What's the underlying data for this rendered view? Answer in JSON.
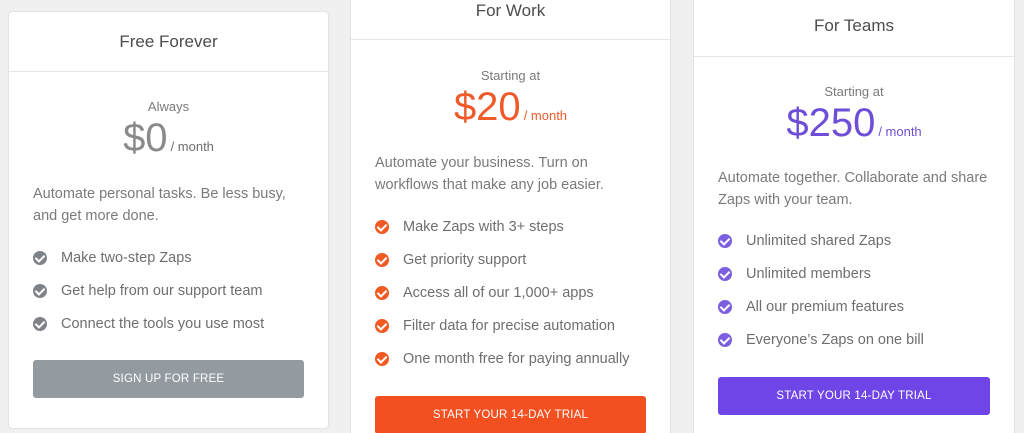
{
  "plans": {
    "free": {
      "title": "Free Forever",
      "lead": "Always",
      "price": "$0",
      "unit": "/ month",
      "description": "Automate personal tasks. Be less busy, and get more done.",
      "features": [
        "Make two-step Zaps",
        "Get help from our support team",
        "Connect the tools you use most"
      ],
      "cta": "SIGN UP FOR FREE",
      "accent": "#7d8388"
    },
    "work": {
      "title": "For Work",
      "lead": "Starting at",
      "price": "$20",
      "unit": "/ month",
      "description": "Automate your business. Turn on workflows that make any job easier.",
      "features": [
        "Make Zaps with 3+ steps",
        "Get priority support",
        "Access all of our 1,000+ apps",
        "Filter data for precise automation",
        "One month free for paying annually"
      ],
      "cta": "START YOUR 14-DAY TRIAL",
      "accent": "#f15a23"
    },
    "teams": {
      "title": "For Teams",
      "lead": "Starting at",
      "price": "$250",
      "unit": "/ month",
      "description": "Automate together. Collaborate and share Zaps with your team.",
      "features": [
        "Unlimited shared Zaps",
        "Unlimited members",
        "All our premium features",
        "Everyone’s Zaps on one bill"
      ],
      "cta": "START YOUR 14-DAY TRIAL",
      "accent": "#7b5fe0"
    }
  }
}
